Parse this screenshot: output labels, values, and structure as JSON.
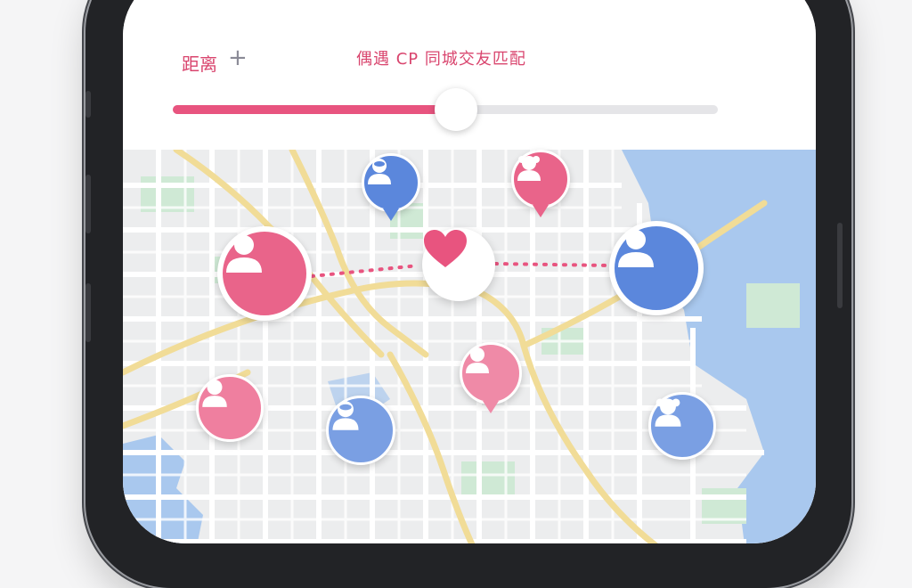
{
  "header": {
    "distance_label": "距离",
    "distance_plus": "+",
    "title": "偶遇 CP 同城交友匹配"
  },
  "slider": {
    "value_fraction": 0.52
  },
  "colors": {
    "accent_pink": "#e8547f",
    "pin_pink": "#e9648a",
    "pin_blue": "#5b87dc",
    "water": "#a9c8ee",
    "park": "#cfe9d5",
    "road_major": "#f1dc97"
  },
  "map": {
    "icons": [
      "person-icon",
      "user-avatar-icon",
      "heart-icon"
    ]
  }
}
